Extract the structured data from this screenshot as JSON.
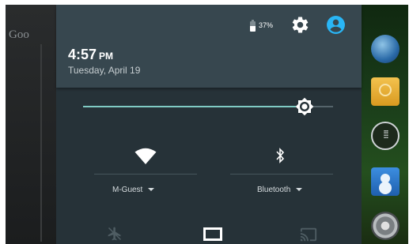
{
  "background": {
    "widget_text": "Goo"
  },
  "status": {
    "battery_percent": "37%",
    "battery_level": 0.37,
    "settings_icon": "gear-icon",
    "user_icon": "account-circle-icon"
  },
  "clock": {
    "time": "4:57",
    "ampm": "PM",
    "date": "Tuesday, April 19"
  },
  "brightness": {
    "level": 0.91
  },
  "tiles": {
    "wifi": {
      "label": "M-Guest",
      "icon": "wifi-icon"
    },
    "bluetooth": {
      "label": "Bluetooth",
      "icon": "bluetooth-icon"
    }
  },
  "bottom_tiles": [
    "airplane-mode-icon",
    "display-icon",
    "cast-icon"
  ],
  "colors": {
    "accent": "#80cbc4",
    "header": "#37474f",
    "panel": "#263238",
    "profile": "#29b6f6"
  }
}
